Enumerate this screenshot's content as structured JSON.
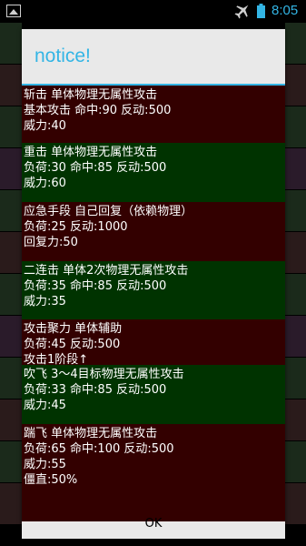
{
  "status_bar": {
    "time": "8:05",
    "icons": [
      "picture-icon",
      "airplane-mode-icon",
      "battery-icon"
    ],
    "accent": "#33b5e5"
  },
  "dialog": {
    "title": "notice!",
    "ok_label": "OK",
    "title_color": "#33b5e5",
    "entries": [
      {
        "bg": "#330000",
        "lines": [
          "斩击 单体物理无属性攻击",
          "基本攻击 命中:90 反动:500",
          "威力:40"
        ]
      },
      {
        "bg": "#003300",
        "lines": [
          "重击 单体物理无属性攻击",
          "负荷:30 命中:85 反动:500",
          "威力:60"
        ]
      },
      {
        "bg": "#330000",
        "lines": [
          "应急手段 自己回复（依赖物理）",
          "负荷:25 反动:1000",
          "回复力:50"
        ]
      },
      {
        "bg": "#003300",
        "lines": [
          "二连击 单体2次物理无属性攻击",
          "负荷:35 命中:85 反动:500",
          "威力:35"
        ]
      },
      {
        "bg": "#330000",
        "lines": [
          "攻击聚力 单体辅助",
          "负荷:45 反动:500",
          "攻击1阶段↑"
        ]
      },
      {
        "bg": "#003300",
        "lines": [
          "吹飞 3～4目标物理无属性攻击",
          "负荷:33 命中:85 反动:500",
          "威力:45"
        ]
      },
      {
        "bg": "#330000",
        "lines": [
          "踹飞 单体物理无属性攻击",
          "负荷:65 命中:100 反动:500",
          "威力:55",
          "僵直:50%"
        ]
      }
    ]
  }
}
